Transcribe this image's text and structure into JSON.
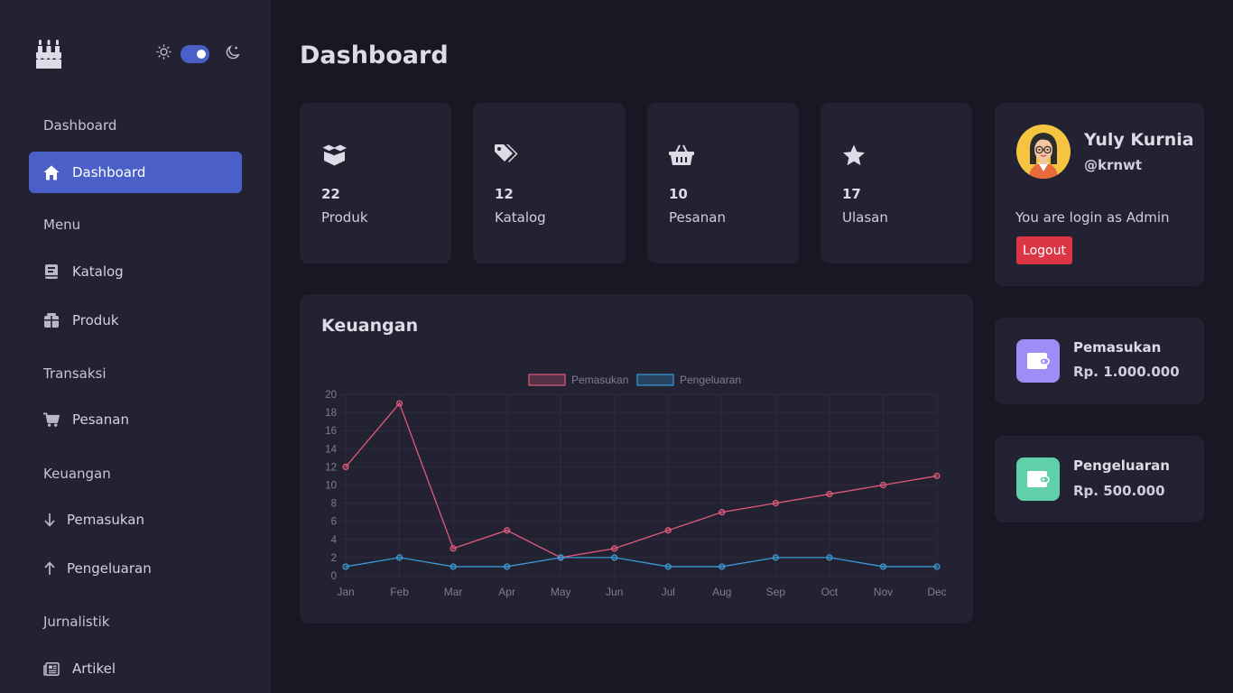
{
  "sidebar": {
    "sections": {
      "dashboard": "Dashboard",
      "menu": "Menu",
      "transaksi": "Transaksi",
      "keuangan": "Keuangan",
      "jurnalistik": "Jurnalistik"
    },
    "items": {
      "dashboard": "Dashboard",
      "katalog": "Katalog",
      "produk": "Produk",
      "pesanan": "Pesanan",
      "pemasukan": "Pemasukan",
      "pengeluaran": "Pengeluaran",
      "artikel": "Artikel"
    },
    "theme": "dark"
  },
  "page": {
    "title": "Dashboard"
  },
  "stats": [
    {
      "value": "22",
      "label": "Produk",
      "icon": "box-icon"
    },
    {
      "value": "12",
      "label": "Katalog",
      "icon": "tags-icon"
    },
    {
      "value": "10",
      "label": "Pesanan",
      "icon": "basket-icon"
    },
    {
      "value": "17",
      "label": "Ulasan",
      "icon": "star-icon"
    }
  ],
  "finance_chart": {
    "title": "Keuangan"
  },
  "chart_data": {
    "type": "line",
    "title": "",
    "categories": [
      "Jan",
      "Feb",
      "Mar",
      "Apr",
      "May",
      "Jun",
      "Jul",
      "Aug",
      "Sep",
      "Oct",
      "Nov",
      "Dec"
    ],
    "series": [
      {
        "name": "Pemasukan",
        "color": "#e05a7a",
        "values": [
          12,
          19,
          3,
          5,
          2,
          3,
          5,
          7,
          8,
          9,
          10,
          11
        ]
      },
      {
        "name": "Pengeluaran",
        "color": "#3a9ad6",
        "values": [
          1,
          2,
          1,
          1,
          2,
          2,
          1,
          1,
          2,
          2,
          1,
          1
        ]
      }
    ],
    "ylim": [
      0,
      20
    ],
    "yticks": [
      0,
      2,
      4,
      6,
      8,
      10,
      12,
      14,
      16,
      18,
      20
    ],
    "grid": true,
    "legend": "top-center",
    "xlabel": "",
    "ylabel": ""
  },
  "profile": {
    "name": "Yuly Kurnia",
    "handle": "@krnwt",
    "login_info": "You are login as Admin",
    "logout_label": "Logout"
  },
  "finance": {
    "income": {
      "title": "Pemasukan",
      "value": "Rp. 1.000.000",
      "color": "#9f8cf7"
    },
    "expense": {
      "title": "Pengeluaran",
      "value": "Rp. 500.000",
      "color": "#5fd0a8"
    }
  }
}
